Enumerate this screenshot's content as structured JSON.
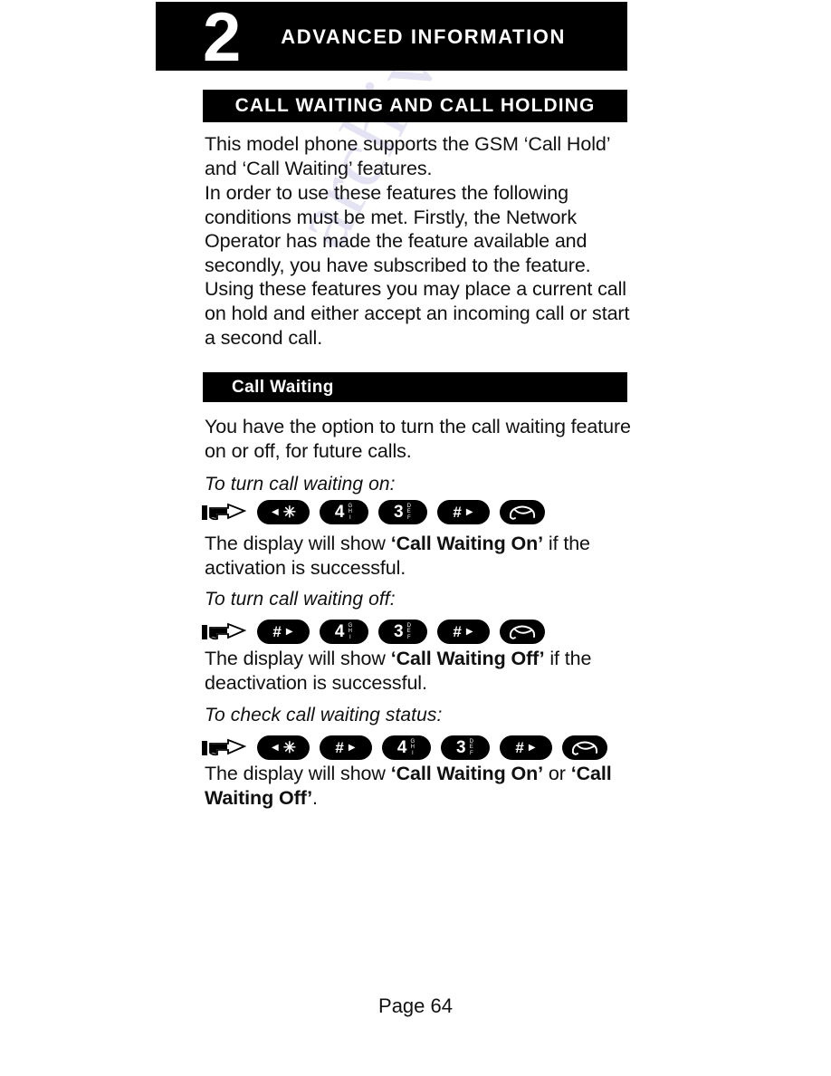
{
  "chapter": {
    "number": "2",
    "title": "ADVANCED INFORMATION"
  },
  "section": {
    "title": "CALL WAITING AND CALL HOLDING"
  },
  "intro": {
    "paragraph1": "This model phone supports the GSM ‘Call Hold’ and ‘Call Waiting’ features.",
    "paragraph2": "In order to use these features the following conditions must be met. Firstly, the Network Operator has made the feature available and secondly, you have subscribed to the feature. Using these features you may place a current call on hold and either accept an incoming call or start a second call."
  },
  "subsection": {
    "title": "Call Waiting",
    "intro": "You have the option to turn the call waiting feature on or off, for future calls."
  },
  "procedures": [
    {
      "caption": "To turn call waiting on:",
      "keys": [
        {
          "icon": "pointing-hand-icon",
          "type": "hand"
        },
        {
          "type": "symbol",
          "arrow": "left",
          "glyph": "✳",
          "label": "star-key"
        },
        {
          "type": "digit",
          "digit": "4",
          "letters": "G\nH\nI",
          "label": "digit-4-key"
        },
        {
          "type": "digit",
          "digit": "3",
          "letters": "D\nE\nF",
          "label": "digit-3-key"
        },
        {
          "type": "symbol",
          "arrow": "right",
          "glyph": "#",
          "label": "hash-key"
        },
        {
          "type": "send",
          "icon": "send-call-icon",
          "label": "send-key"
        }
      ],
      "result_prefix": "The display will show ",
      "result_bold": "‘Call Waiting On’",
      "result_suffix": " if the activation is successful."
    },
    {
      "caption": "To turn call waiting off:",
      "keys": [
        {
          "icon": "pointing-hand-icon",
          "type": "hand"
        },
        {
          "type": "symbol",
          "arrow": "right",
          "glyph": "#",
          "label": "hash-key"
        },
        {
          "type": "digit",
          "digit": "4",
          "letters": "G\nH\nI",
          "label": "digit-4-key"
        },
        {
          "type": "digit",
          "digit": "3",
          "letters": "D\nE\nF",
          "label": "digit-3-key"
        },
        {
          "type": "symbol",
          "arrow": "right",
          "glyph": "#",
          "label": "hash-key"
        },
        {
          "type": "send",
          "icon": "send-call-icon",
          "label": "send-key"
        }
      ],
      "result_prefix": "The display will show ",
      "result_bold": "‘Call Waiting Off’",
      "result_suffix": " if the deactivation is successful."
    },
    {
      "caption": "To check call waiting status:",
      "keys": [
        {
          "icon": "pointing-hand-icon",
          "type": "hand"
        },
        {
          "type": "symbol",
          "arrow": "left",
          "glyph": "✳",
          "label": "star-key"
        },
        {
          "type": "symbol",
          "arrow": "right",
          "glyph": "#",
          "label": "hash-key"
        },
        {
          "type": "digit",
          "digit": "4",
          "letters": "G\nH\nI",
          "label": "digit-4-key"
        },
        {
          "type": "digit",
          "digit": "3",
          "letters": "D\nE\nF",
          "label": "digit-3-key"
        },
        {
          "type": "symbol",
          "arrow": "right",
          "glyph": "#",
          "label": "hash-key"
        },
        {
          "type": "send",
          "icon": "send-call-icon",
          "label": "send-key"
        }
      ],
      "result_prefix": "The display will show ",
      "result_bold": "‘Call Waiting On’",
      "result_suffix": " or ",
      "result_bold2": "‘Call Waiting Off’",
      "result_suffix2": "."
    }
  ],
  "footer": {
    "page_label": "Page 64"
  },
  "watermark": {
    "text": "archive.com"
  },
  "colors": {
    "banner_background": "#000000",
    "banner_text": "#ffffff",
    "body_text": "#101010",
    "page_background": "#ffffff",
    "watermark": "#4a3fb5"
  }
}
